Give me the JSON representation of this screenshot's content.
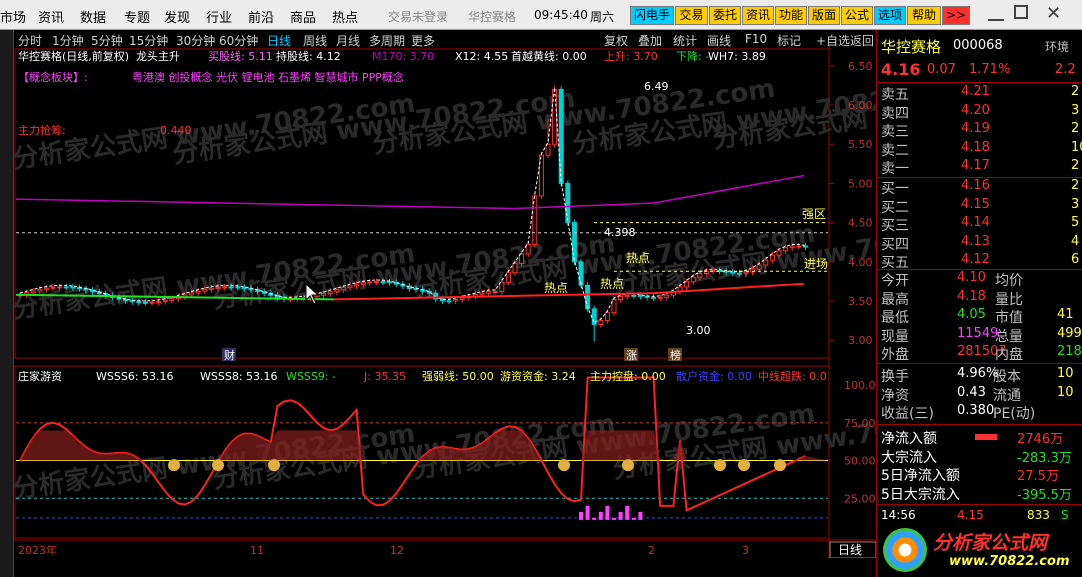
{
  "menu": {
    "items": [
      "市场",
      "资讯",
      "数据",
      "专题",
      "发现",
      "行业",
      "前沿",
      "商品",
      "热点"
    ],
    "login": "交易未登录",
    "app_name": "华控赛格",
    "time": "09:45:40",
    "weekday": "周六",
    "buttons": [
      {
        "label": "闪电手",
        "bg": "#00ccff"
      },
      {
        "label": "交易",
        "bg": "#ffcc00"
      },
      {
        "label": "委托",
        "bg": "#ffcc00"
      },
      {
        "label": "资讯",
        "bg": "#ffcc00"
      },
      {
        "label": "功能",
        "bg": "#ffcc00"
      },
      {
        "label": "版面",
        "bg": "#ffcc00"
      },
      {
        "label": "公式",
        "bg": "#ffcc00"
      },
      {
        "label": "选项",
        "bg": "#00ccff"
      },
      {
        "label": "帮助",
        "bg": "#ffcc00"
      },
      {
        "label": ">>",
        "bg": "#ff3030"
      }
    ]
  },
  "periods": {
    "items": [
      "分时",
      "1分钟",
      "5分钟",
      "15分钟",
      "30分钟",
      "60分钟",
      "日线",
      "周线",
      "月线",
      "多周期",
      "更多"
    ],
    "active": "日线"
  },
  "tools": [
    "复权",
    "叠加",
    "统计",
    "画线",
    "F10",
    "标记",
    "+自选",
    "返回"
  ],
  "main": {
    "title": "华控赛格(日线,前复权)",
    "formula": "龙头主升",
    "buy_label": "买股线: 5.11",
    "hold_label": "持股线: 4.12",
    "m170": "M170: 3.70",
    "x12": "X12: 4.55",
    "yellow_line": "首越黄线: 0.00",
    "up": "上升: 3.70",
    "down": "下降: -",
    "wh7": "WH7: 3.89",
    "concept_label": "【概念板块】:",
    "concepts": "粤港澳 创投概念 光伏 锂电池 石墨烯 智慧城市 PPP概念",
    "zl_label": "主力抢筹:",
    "zl_value": "0.440",
    "hot_label": "热点",
    "strong_label": "强区",
    "enter_label": "进场",
    "high_label": "6.49",
    "low_label": "3.00",
    "mid_label": "4.398",
    "axis": [
      "6.50",
      "6.00",
      "5.50",
      "5.00",
      "4.50",
      "4.00",
      "3.50",
      "3.00"
    ],
    "marks": [
      "财",
      "涨",
      "榜"
    ]
  },
  "sub": {
    "title": "庄家游资",
    "wsss6": "WSSS6: 53.16",
    "wsss8": "WSSS8: 53.16",
    "wsss9": "WSSS9: -",
    "j": "J: 35.35",
    "strong": "强弱线: 50.00",
    "hot": "游资资金: 3.24",
    "main": "主力控盘: 0.00",
    "retail": "散户资金: 0.00",
    "mid": "中线超跌: 0.0",
    "axis": [
      "100.0",
      "75.00",
      "50.00",
      "25.00"
    ]
  },
  "dates": [
    "2023年",
    "11",
    "12",
    "2",
    "3"
  ],
  "rpanel": {
    "name": "华控赛格",
    "code": "000068",
    "env": "环境",
    "price": "4.16",
    "change": "0.07",
    "pct": "1.71%",
    "pct_right": "2.2",
    "sells": [
      {
        "l": "卖五",
        "p": "4.21",
        "v": "2"
      },
      {
        "l": "卖四",
        "p": "4.20",
        "v": "3"
      },
      {
        "l": "卖三",
        "p": "4.19",
        "v": "2"
      },
      {
        "l": "卖二",
        "p": "4.18",
        "v": "10"
      },
      {
        "l": "卖一",
        "p": "4.17",
        "v": "2"
      }
    ],
    "buys": [
      {
        "l": "买一",
        "p": "4.16",
        "v": "2"
      },
      {
        "l": "买二",
        "p": "4.15",
        "v": "3"
      },
      {
        "l": "买三",
        "p": "4.14",
        "v": "5"
      },
      {
        "l": "买四",
        "p": "4.13",
        "v": "4"
      },
      {
        "l": "买五",
        "p": "4.12",
        "v": "6"
      }
    ],
    "stats": [
      [
        "今开",
        "4.10",
        "均价",
        ""
      ],
      [
        "最高",
        "4.18",
        "量比",
        ""
      ],
      [
        "最低",
        "4.05",
        "市值",
        "41"
      ],
      [
        "现量",
        "11549",
        "总量",
        "499"
      ],
      [
        "外盘",
        "281507",
        "内盘",
        "218"
      ]
    ],
    "stats2": [
      [
        "换手",
        "4.96%",
        "股本",
        "10"
      ],
      [
        "净资",
        "0.43",
        "流通",
        "10"
      ],
      [
        "收益(三)",
        "0.380",
        "PE(动)",
        ""
      ]
    ],
    "flows": [
      [
        "净流入额",
        "2746万"
      ],
      [
        "大宗流入",
        "-283.3万"
      ],
      [
        "5日净流入额",
        "27.5万"
      ],
      [
        "5日大宗流入",
        "-395.5万"
      ]
    ],
    "tick_time": "14:56",
    "tick_price": "4.15",
    "tick_vol": "833",
    "tick_s": "S"
  },
  "footer": {
    "tab": "日线"
  },
  "watermark": {
    "brand": "分析家公式网",
    "url": "www.70822.com",
    "text": "分析家公式网 www.70822.com"
  },
  "chart_data": {
    "type": "candlestick",
    "x_range": [
      "2023-10",
      "2024-03"
    ],
    "y_range": [
      2.9,
      6.6
    ],
    "last_close": 4.16,
    "high": 6.49,
    "low": 3.0
  }
}
